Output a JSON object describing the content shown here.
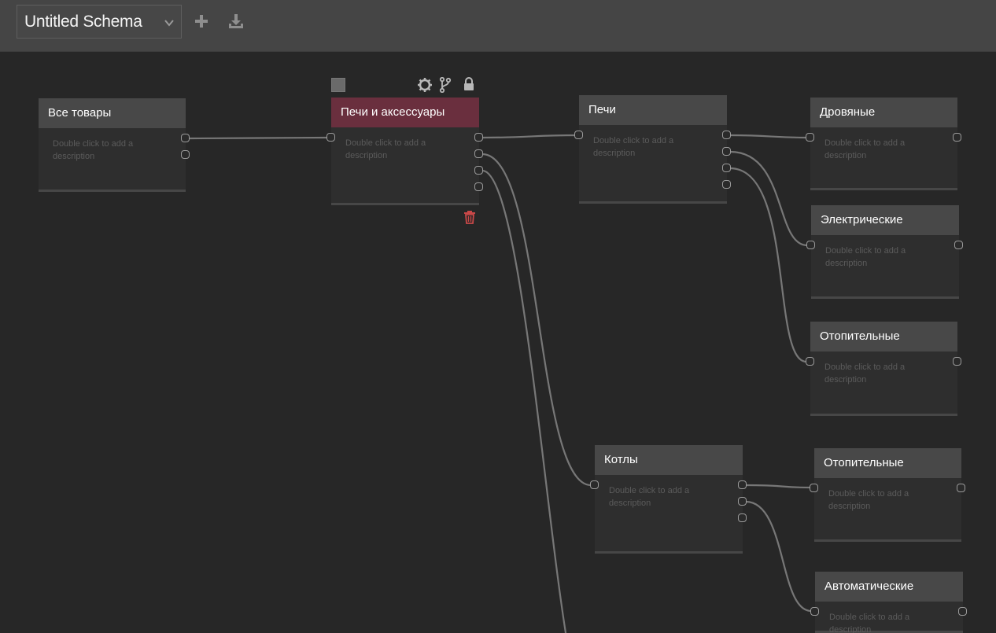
{
  "toolbar": {
    "schema_title": "Untitled Schema",
    "add_icon": "plus-icon",
    "download_icon": "download-icon"
  },
  "colors": {
    "topbar": "#454545",
    "canvas": "#272727",
    "node_header": "#484848",
    "node_header_selected": "#6a2f3e",
    "delete": "#c94848"
  },
  "nodes": [
    {
      "id": "n1",
      "title": "Все товары",
      "description": "Double click to add a description"
    },
    {
      "id": "n2",
      "title": "Печи и аксессуары",
      "description": "Double click to add a description",
      "selected": true
    },
    {
      "id": "n3",
      "title": "Печи",
      "description": "Double click to add a description"
    },
    {
      "id": "n4",
      "title": "Дровяные",
      "description": "Double click to add a description"
    },
    {
      "id": "n5",
      "title": "Электрические",
      "description": "Double click to add a description"
    },
    {
      "id": "n6",
      "title": "Отопительные",
      "description": "Double click to add a description"
    },
    {
      "id": "n7",
      "title": "Котлы",
      "description": "Double click to add a description"
    },
    {
      "id": "n8",
      "title": "Отопительные",
      "description": "Double click to add a description"
    },
    {
      "id": "n9",
      "title": "Автоматические",
      "description": "Double click to add a description"
    }
  ],
  "node_tools": {
    "color_swatch": "color-swatch",
    "settings_icon": "gear-icon",
    "branch_icon": "branch-icon",
    "lock_icon": "lock-icon",
    "delete_icon": "trash-icon"
  }
}
